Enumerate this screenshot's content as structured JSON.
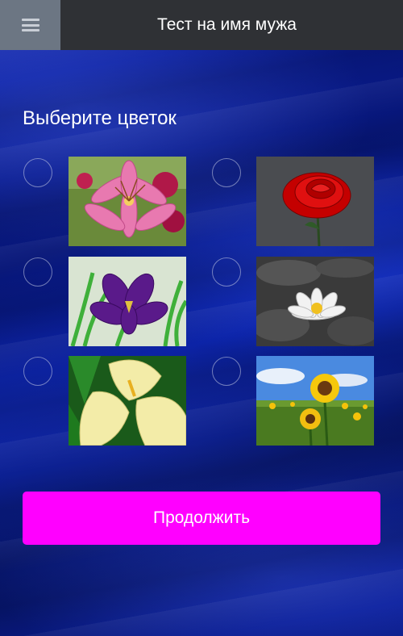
{
  "header": {
    "title": "Тест на имя мужа",
    "menu_icon": "hamburger-menu-icon"
  },
  "main": {
    "heading": "Выберите цветок",
    "options": [
      {
        "flower": "lily",
        "selected": false
      },
      {
        "flower": "rose",
        "selected": false
      },
      {
        "flower": "iris",
        "selected": false
      },
      {
        "flower": "water-lily",
        "selected": false
      },
      {
        "flower": "calla",
        "selected": false
      },
      {
        "flower": "sunflower",
        "selected": false
      }
    ],
    "continue_label": "Продолжить"
  },
  "colors": {
    "topbar": "#2f3135",
    "menu_button": "#6c7683",
    "background": "#0a1a8a",
    "accent": "#ff00ff"
  }
}
